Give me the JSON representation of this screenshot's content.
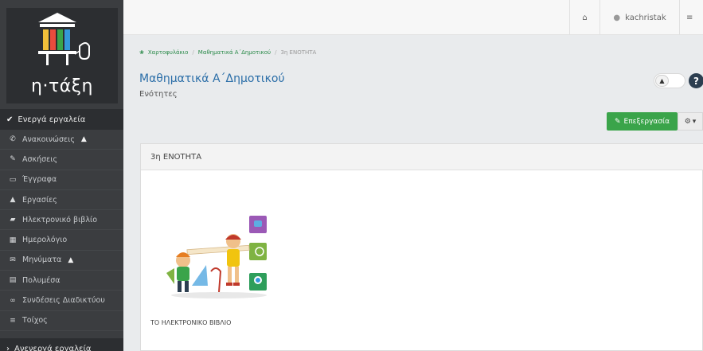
{
  "app": {
    "logo_text": "η·τάξη"
  },
  "sidebar": {
    "active_header": "Ενεργά εργαλεία",
    "inactive_header": "Ανενεργά εργαλεία",
    "items": [
      {
        "label": "Ανακοινώσεις",
        "icon": "megaphone-icon",
        "warning": true
      },
      {
        "label": "Ασκήσεις",
        "icon": "edit-icon",
        "warning": false
      },
      {
        "label": "Έγγραφα",
        "icon": "folder-icon",
        "warning": false
      },
      {
        "label": "Εργασίες",
        "icon": "flask-icon",
        "warning": false
      },
      {
        "label": "Ηλεκτρονικό βιβλίο",
        "icon": "book-icon",
        "warning": false
      },
      {
        "label": "Ημερολόγιο",
        "icon": "calendar-icon",
        "warning": false
      },
      {
        "label": "Μηνύματα",
        "icon": "envelope-icon",
        "warning": true
      },
      {
        "label": "Πολυμέσα",
        "icon": "film-icon",
        "warning": false
      },
      {
        "label": "Συνδέσεις Διαδικτύου",
        "icon": "link-icon",
        "warning": false
      },
      {
        "label": "Τοίχος",
        "icon": "list-icon",
        "warning": false
      }
    ]
  },
  "topbar": {
    "username": "kachristak"
  },
  "breadcrumb": {
    "items": [
      "Χαρτοφυλάκιο",
      "Μαθηματικά Α΄Δημοτικού",
      "3η ΕΝΟΤΗΤΑ"
    ]
  },
  "page": {
    "title": "Μαθηματικά Α΄Δημοτικού",
    "subtitle": "Ενότητες",
    "edit_label": "Επεξεργασία",
    "help_label": "?"
  },
  "panel": {
    "title": "3η ΕΝΟΤΗΤΑ",
    "caption": "ΤΟ ΗΛΕΚΤΡΟΝΙΚΟ ΒΙΒΛΙΟ"
  },
  "colors": {
    "sidebar_bg": "#3b3d40",
    "accent_green": "#3aa44a",
    "link_blue": "#2b6ea8"
  }
}
